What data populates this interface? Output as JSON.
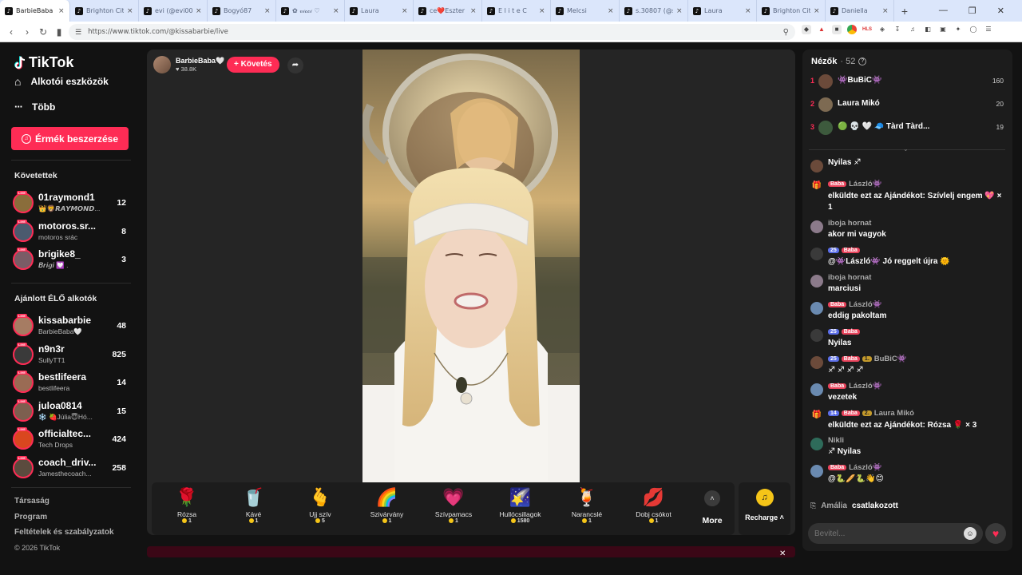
{
  "browser": {
    "tabs": [
      {
        "title": "BarbieBaba",
        "active": true
      },
      {
        "title": "Brighton City"
      },
      {
        "title": "evi (@evi0013..."
      },
      {
        "title": "Bogyó87"
      },
      {
        "title": "✿ 𝓋𝒾𝒸𝒸𝒾 ♡"
      },
      {
        "title": "Laura"
      },
      {
        "title": "ce❤️Eszter"
      },
      {
        "title": "E l i t e C"
      },
      {
        "title": "Melcsi"
      },
      {
        "title": "s.30807 (@s..."
      },
      {
        "title": "Laura"
      },
      {
        "title": "Brighton City"
      },
      {
        "title": "Daniella"
      }
    ],
    "new_tab": "+",
    "url": "https://www.tiktok.com/@kissabarbie/live"
  },
  "sidebar": {
    "logo": "TikTok",
    "creator_tools": "Alkotói eszközök",
    "more": "Több",
    "coins_button": "Érmék beszerzése",
    "following_title": "Követettek",
    "following": [
      {
        "name": "01raymond1",
        "sub": "👑🦁𝙍𝘼𝙔𝙈𝙊𝙉𝘿...",
        "count": "12",
        "color": "#8a6d3b"
      },
      {
        "name": "motoros.sr...",
        "sub": "motoros srác",
        "count": "8",
        "color": "#4b5a6e"
      },
      {
        "name": "brigike8_",
        "sub": "𝑩𝒓𝒊𝒈𝒊 💟 .",
        "count": "3",
        "color": "#7a5c66"
      }
    ],
    "recommended_title": "Ajánlott ÉLŐ alkotók",
    "recommended": [
      {
        "name": "kissabarbie",
        "sub": "BarbieBaba🤍",
        "count": "48",
        "color": "#a67c63"
      },
      {
        "name": "n9n3r",
        "sub": "SullyTT1",
        "count": "825",
        "color": "#3a3a3a"
      },
      {
        "name": "bestlifeera",
        "sub": "bestlifeera",
        "count": "14",
        "color": "#9a6b54"
      },
      {
        "name": "juloa0814",
        "sub": "❄️ 🍓Júlia😇Hó...",
        "count": "15",
        "color": "#7d5f4f"
      },
      {
        "name": "officialtec...",
        "sub": "Tech Drops",
        "count": "424",
        "color": "#d9471f"
      },
      {
        "name": "coach_driv...",
        "sub": "Jamesthecoach...",
        "count": "258",
        "color": "#5b4b3e"
      }
    ],
    "footer": [
      "Társaság",
      "Program",
      "Feltételek és szabályzatok",
      "© 2026 TikTok"
    ]
  },
  "stage": {
    "host_name": "BarbieBaba🤍",
    "host_likes": "38.8K",
    "follow_button": "+ Követés",
    "gifts": [
      {
        "icon": "🌹",
        "name": "Rózsa",
        "price": "1"
      },
      {
        "icon": "🥤",
        "name": "Kávé",
        "price": "1"
      },
      {
        "icon": "🫰",
        "name": "Ujj szív",
        "price": "5"
      },
      {
        "icon": "🌈",
        "name": "Szivárvány",
        "price": "1"
      },
      {
        "icon": "💗",
        "name": "Szívpamacs",
        "price": "1"
      },
      {
        "icon": "🌠",
        "name": "Hullócsillagok",
        "price": "1580"
      },
      {
        "icon": "🍹",
        "name": "Narancslé",
        "price": "1"
      },
      {
        "icon": "💋",
        "name": "Dobj csókot",
        "price": "1"
      }
    ],
    "more_label": "More",
    "recharge_label": "Recharge"
  },
  "viewers": {
    "title": "Nézők",
    "count": "· 52",
    "top": [
      {
        "rank": "1",
        "name": "👾BuBiC👾",
        "score": "160",
        "color": "#6b4a3a"
      },
      {
        "rank": "2",
        "name": "Laura Mikó",
        "score": "20",
        "color": "#7d6a52"
      },
      {
        "rank": "3",
        "name": "🟢 💀 🤍 🧢 Tàrd Tàrd...",
        "score": "19",
        "color": "#3d5a3d"
      }
    ]
  },
  "chat": [
    {
      "user": "",
      "badges": [],
      "text": "Nyilas ♐",
      "color": "#6a4a3a"
    },
    {
      "gift": true,
      "user": "László👾",
      "badges": [
        "Baba"
      ],
      "text": "elküldte ezt az Ajándékot: Szívlelj engem 💖 × 1"
    },
    {
      "user": "iboja hornat",
      "badges": [],
      "text": "akor mi vagyok",
      "color": "#8b7a8a"
    },
    {
      "user": "",
      "badges": [
        "25",
        "Baba"
      ],
      "text": "@👾László👾 Jó reggelt újra 🌞",
      "color": "#3a3a3a"
    },
    {
      "user": "iboja hornat",
      "badges": [],
      "text": "marciusi",
      "color": "#8b7a8a"
    },
    {
      "user": "László👾",
      "badges": [
        "Baba"
      ],
      "text": "eddig pakoltam",
      "color": "#6a8ab0"
    },
    {
      "user": "",
      "badges": [
        "25",
        "Baba"
      ],
      "text": "Nyilas",
      "color": "#3a3a3a"
    },
    {
      "user": "BuBiC👾",
      "badges": [
        "25",
        "Baba",
        "1."
      ],
      "text": "♐ ♐ ♐ ♐",
      "color": "#6b4a3a"
    },
    {
      "user": "László👾",
      "badges": [
        "Baba"
      ],
      "text": "vezetek",
      "color": "#6a8ab0"
    },
    {
      "gift": true,
      "user": "Laura Mikó",
      "badges": [
        "14",
        "Baba",
        "2."
      ],
      "text": "elküldte ezt az Ajándékot: Rózsa 🌹 × 3"
    },
    {
      "user": "Nikli",
      "badges": [],
      "text": "♐ Nyilas",
      "color": "#2e6b5a"
    },
    {
      "user": "László👾",
      "badges": [
        "Baba"
      ],
      "text": "@🐍🥖🐍👋😊",
      "color": "#6a8ab0"
    }
  ],
  "joined": {
    "user": "Amália",
    "action": "csatlakozott"
  },
  "input": {
    "placeholder": "Bevitel..."
  },
  "colors": {
    "accent": "#fe2c55",
    "bg": "#121212",
    "panel": "#1c1c1c"
  }
}
